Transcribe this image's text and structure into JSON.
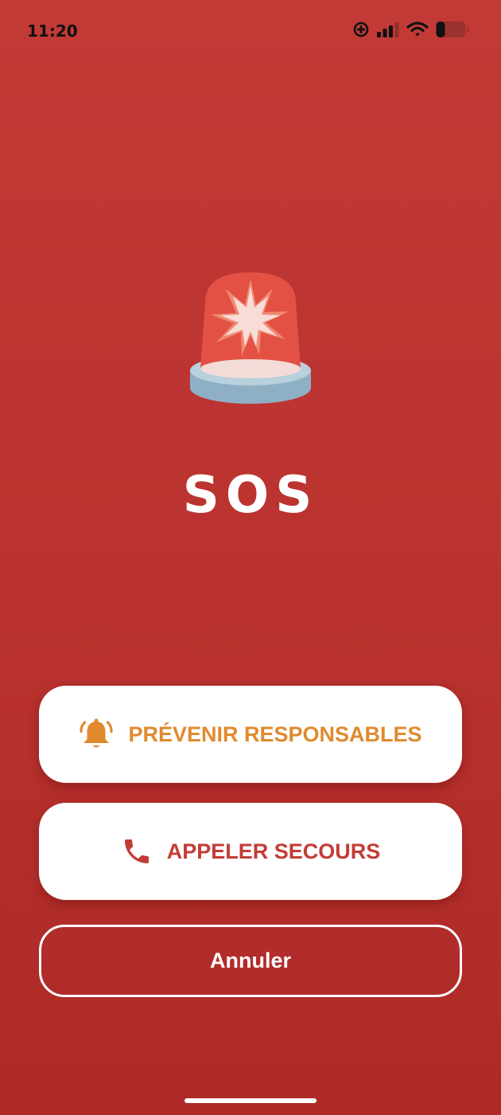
{
  "status_bar": {
    "time": "11:20"
  },
  "main": {
    "title": "SOS"
  },
  "actions": {
    "notify_label": "PRÉVENIR RESPONSABLES",
    "call_label": "APPELER SECOURS",
    "cancel_label": "Annuler"
  },
  "colors": {
    "background": "#bf3733",
    "notify_accent": "#e08a2e",
    "call_accent": "#c23c36",
    "button_background": "#ffffff"
  },
  "icons": {
    "hero": "siren-icon",
    "notify": "bell-ringing-icon",
    "call": "phone-icon"
  }
}
